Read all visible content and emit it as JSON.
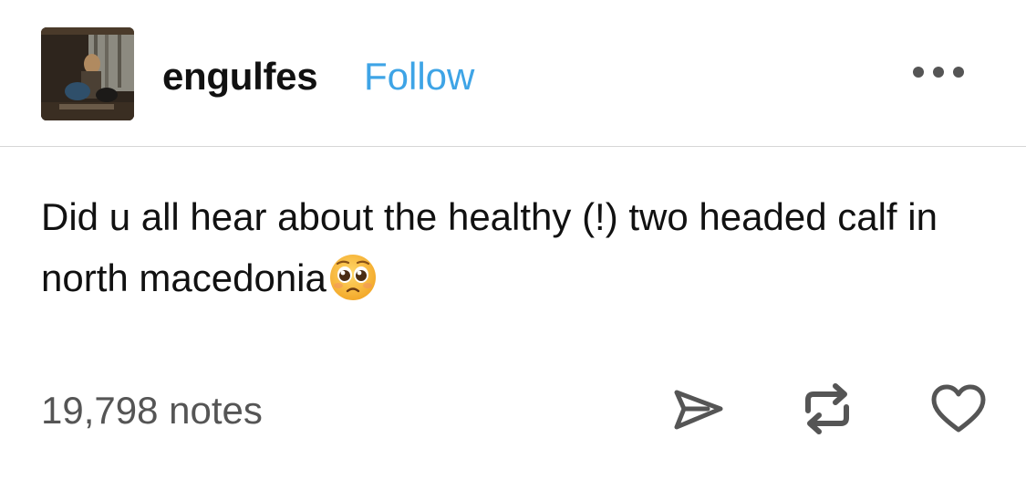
{
  "post": {
    "username": "engulfes",
    "follow_label": "Follow",
    "more_icon": "more-horizontal-icon",
    "body_text": "Did u all hear about the healthy (!) two headed calf in north macedonia",
    "body_emoji": "pleading-face-emoji",
    "notes_label": "19,798 notes",
    "actions": {
      "share_icon": "share-icon",
      "reblog_icon": "reblog-icon",
      "like_icon": "heart-icon"
    }
  },
  "colors": {
    "accent": "#3ea4e6",
    "text": "#111111",
    "muted": "#555555",
    "divider": "#d6d6d6"
  }
}
